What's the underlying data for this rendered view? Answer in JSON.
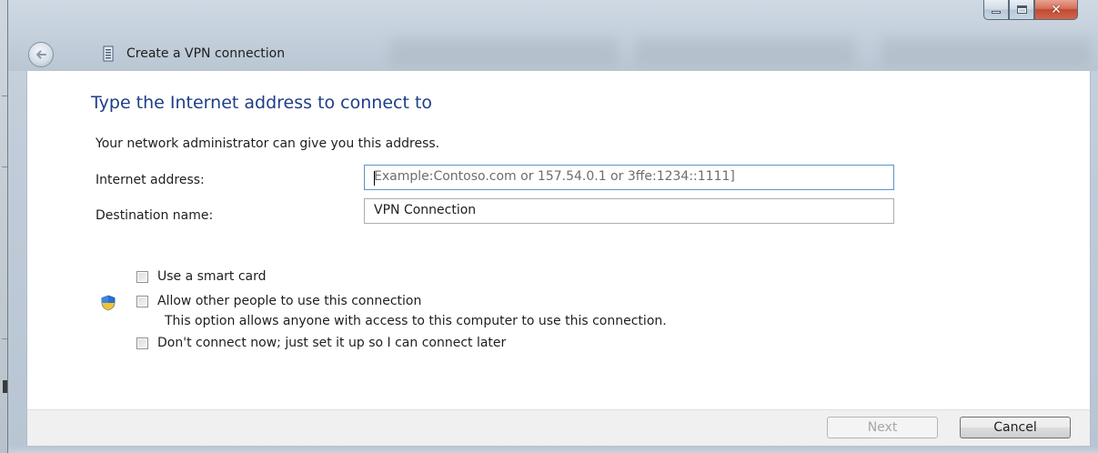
{
  "window": {
    "title": "Create a VPN connection"
  },
  "wizard": {
    "heading": "Type the Internet address to connect to",
    "subtext": "Your network administrator can give you this address.",
    "address_label": "Internet address:",
    "address_placeholder": "Example:Contoso.com or 157.54.0.1 or 3ffe:1234::1111]",
    "destination_label": "Destination name:",
    "destination_value": "VPN Connection",
    "smart_card_label": "Use a smart card",
    "allow_others_label": "Allow other people to use this connection",
    "allow_others_note": "This option allows anyone with access to this computer to use this connection.",
    "dont_connect_label": "Don't connect now; just set it up so I can connect later"
  },
  "buttons": {
    "next": "Next",
    "cancel": "Cancel"
  },
  "colors": {
    "heading": "#1e3e88",
    "close_button": "#c24a33",
    "input_focus_border": "#5c93c7"
  },
  "icons": {
    "back": "back-arrow-icon",
    "vpn": "vpn-icon",
    "uac": "uac-shield-icon",
    "minimize": "minimize-icon",
    "maximize": "maximize-icon",
    "close": "close-icon"
  }
}
